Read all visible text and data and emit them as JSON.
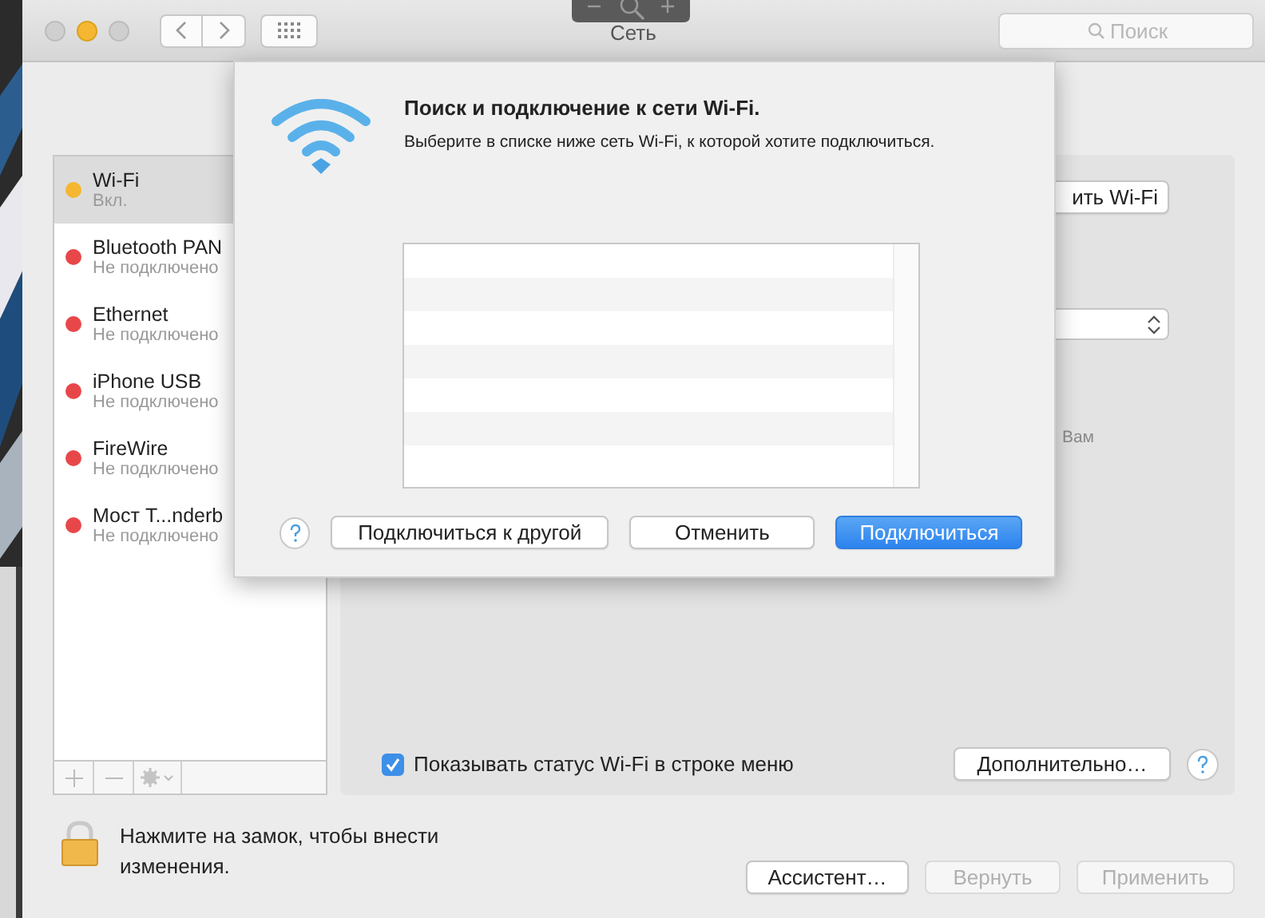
{
  "window": {
    "title": "Сеть",
    "search": {
      "placeholder": "Поиск"
    }
  },
  "services": [
    {
      "name": "Wi-Fi",
      "status": "Вкл.",
      "color": "#f5b731",
      "selected": true
    },
    {
      "name": "Bluetooth PAN",
      "status": "Не подключено",
      "color": "#e8474a",
      "selected": false
    },
    {
      "name": "Ethernet",
      "status": "Не подключено",
      "color": "#e8474a",
      "selected": false
    },
    {
      "name": "iPhone USB",
      "status": "Не подключено",
      "color": "#e8474a",
      "selected": false
    },
    {
      "name": "FireWire",
      "status": "Не подключено",
      "color": "#e8474a",
      "selected": false
    },
    {
      "name": "Мост T...nderb",
      "status": "Не подключено",
      "color": "#e8474a",
      "selected": false
    }
  ],
  "panel": {
    "wifi_button": "ить Wi-Fi",
    "note": "Вам",
    "show_status": {
      "label": "Показывать статус Wi-Fi в строке меню",
      "checked": true
    },
    "advanced_button": "Дополнительно…"
  },
  "lock": {
    "text": "Нажмите на замок, чтобы внести изменения."
  },
  "footer_buttons": [
    {
      "label": "Ассистент…",
      "disabled": false
    },
    {
      "label": "Вернуть",
      "disabled": true
    },
    {
      "label": "Применить",
      "disabled": true
    }
  ],
  "dialog": {
    "title": "Поиск и подключение к сети Wi-Fi.",
    "message": "Выберите в списке ниже сеть Wi-Fi, к которой хотите подключиться.",
    "buttons": [
      {
        "label": "Подключиться к другой",
        "kind": "normal"
      },
      {
        "label": "Отменить",
        "kind": "normal"
      },
      {
        "label": "Подключиться",
        "kind": "default"
      }
    ]
  }
}
